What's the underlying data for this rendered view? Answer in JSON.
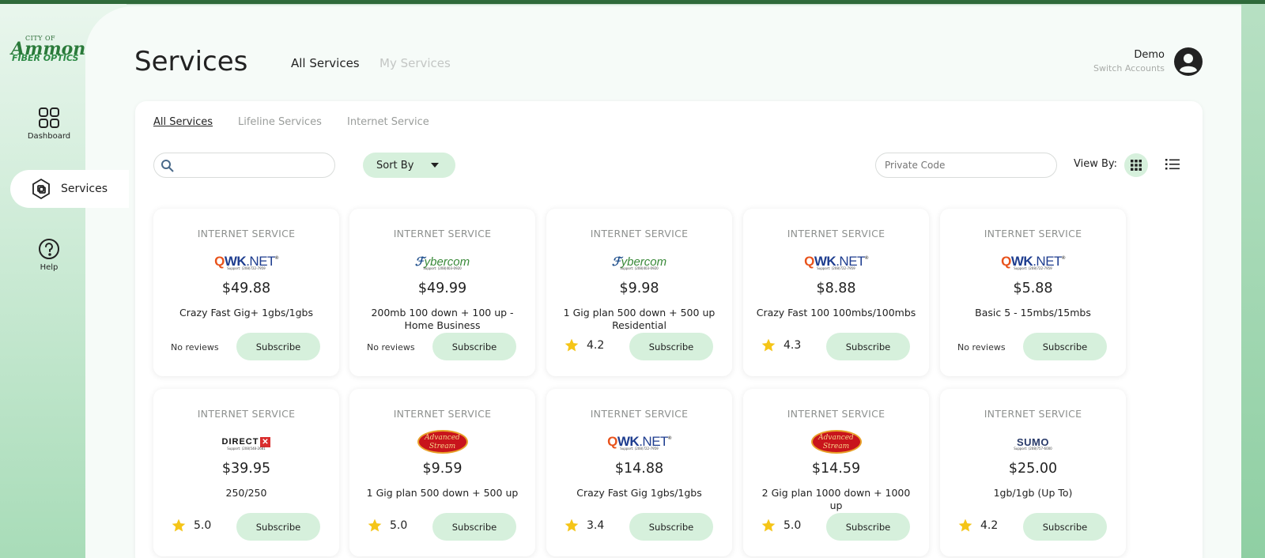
{
  "brand": {
    "line1": "CITY OF",
    "line2": "Ammon",
    "line3": "FIBER OPTICS"
  },
  "sidebar": {
    "items": [
      {
        "label": "Dashboard",
        "icon": "grid-icon"
      },
      {
        "label": "Services",
        "icon": "services-icon",
        "active": true
      },
      {
        "label": "Help",
        "icon": "help-icon"
      }
    ]
  },
  "header": {
    "title": "Services",
    "tabs": [
      {
        "label": "All Services",
        "active": true
      },
      {
        "label": "My Services",
        "active": false
      }
    ],
    "user": {
      "name": "Demo",
      "switch_label": "Switch Accounts"
    }
  },
  "filters": {
    "sub_tabs": [
      {
        "label": "All Services",
        "active": true
      },
      {
        "label": "Lifeline Services"
      },
      {
        "label": "Internet Service"
      }
    ],
    "search": {
      "placeholder": "",
      "value": ""
    },
    "sort_label": "Sort By",
    "private_code_placeholder": "Private Code",
    "view_by_label": "View By:"
  },
  "colors": {
    "accent": "#d6f0dc",
    "star": "#f5c518",
    "header_bar": "#2f6a3a"
  },
  "cards": [
    {
      "category": "INTERNET SERVICE",
      "provider": "QWK.NET",
      "price": "$49.88",
      "description": "Crazy Fast Gig+ 1gbs/1gbs",
      "reviews": "No reviews",
      "rating": null,
      "button": "Subscribe"
    },
    {
      "category": "INTERNET SERVICE",
      "provider": "Fybercom",
      "price": "$49.99",
      "description": "200mb 100 down + 100 up - Home Business",
      "reviews": "No reviews",
      "rating": null,
      "button": "Subscribe"
    },
    {
      "category": "INTERNET SERVICE",
      "provider": "Fybercom",
      "price": "$9.98",
      "description": "1 Gig plan 500 down + 500 up Residential",
      "reviews": null,
      "rating": "4.2",
      "button": "Subscribe"
    },
    {
      "category": "INTERNET SERVICE",
      "provider": "QWK.NET",
      "price": "$8.88",
      "description": "Crazy Fast 100 100mbs/100mbs",
      "reviews": null,
      "rating": "4.3",
      "button": "Subscribe"
    },
    {
      "category": "INTERNET SERVICE",
      "provider": "QWK.NET",
      "price": "$5.88",
      "description": "Basic 5 - 15mbs/15mbs",
      "reviews": "No reviews",
      "rating": null,
      "button": "Subscribe"
    },
    {
      "category": "INTERNET SERVICE",
      "provider": "DIRECT",
      "price": "$39.95",
      "description": "250/250",
      "reviews": null,
      "rating": "5.0",
      "button": "Subscribe"
    },
    {
      "category": "INTERNET SERVICE",
      "provider": "Advanced Stream",
      "price": "$9.59",
      "description": "1 Gig plan 500 down + 500 up",
      "reviews": null,
      "rating": "5.0",
      "button": "Subscribe"
    },
    {
      "category": "INTERNET SERVICE",
      "provider": "QWK.NET",
      "price": "$14.88",
      "description": "Crazy Fast Gig 1gbs/1gbs",
      "reviews": null,
      "rating": "3.4",
      "button": "Subscribe"
    },
    {
      "category": "INTERNET SERVICE",
      "provider": "Advanced Stream",
      "price": "$14.59",
      "description": "2 Gig plan 1000 down + 1000 up",
      "reviews": null,
      "rating": "5.0",
      "button": "Subscribe"
    },
    {
      "category": "INTERNET SERVICE",
      "provider": "SUMO",
      "price": "$25.00",
      "description": "1gb/1gb (Up To)",
      "reviews": null,
      "rating": "4.2",
      "button": "Subscribe"
    }
  ]
}
